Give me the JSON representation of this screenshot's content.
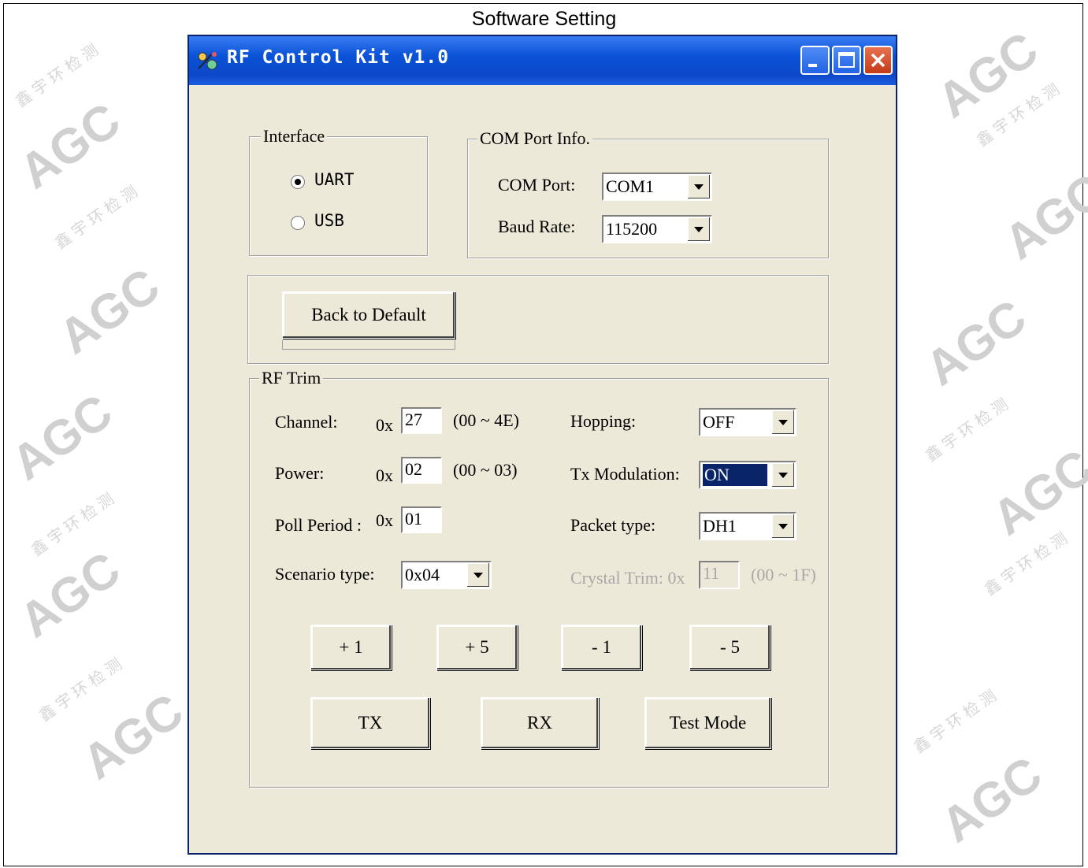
{
  "caption": "Software Setting",
  "watermark": {
    "logo": "AGC",
    "cn_text": "鑫 宇 环 检 测"
  },
  "window": {
    "title": "RF Control Kit v1.0",
    "controls": [
      "minimize",
      "maximize",
      "close"
    ]
  },
  "interface_group": {
    "legend": "Interface",
    "options": [
      {
        "label": "UART",
        "selected": true
      },
      {
        "label": "USB",
        "selected": false
      }
    ]
  },
  "com_group": {
    "legend": "COM Port Info.",
    "com_port_label": "COM Port:",
    "com_port_value": "COM1",
    "baud_label": "Baud Rate:",
    "baud_value": "115200"
  },
  "default_button": "Back to Default",
  "rf_trim": {
    "legend": "RF Trim",
    "channel_label": "Channel:",
    "channel_prefix": "0x",
    "channel_value": "27",
    "channel_range": "(00 ~ 4E)",
    "power_label": "Power:",
    "power_prefix": "0x",
    "power_value": "02",
    "power_range": "(00 ~ 03)",
    "poll_label": "Poll Period :",
    "poll_prefix": "0x",
    "poll_value": "01",
    "scenario_label": "Scenario type:",
    "scenario_value": "0x04",
    "hopping_label": "Hopping:",
    "hopping_value": "OFF",
    "txmod_label": "Tx Modulation:",
    "txmod_value": "ON",
    "packet_label": "Packet type:",
    "packet_value": "DH1",
    "crystal_label": "Crystal Trim: 0x",
    "crystal_value": "11",
    "crystal_range": "(00 ~ 1F)",
    "step_buttons": [
      "+ 1",
      "+ 5",
      "- 1",
      "- 5"
    ],
    "action_buttons": [
      "TX",
      "RX",
      "Test Mode"
    ]
  },
  "colors": {
    "titlebar": "#0a52d6",
    "dialog_bg": "#ece9d8",
    "selection": "#0a246a"
  }
}
